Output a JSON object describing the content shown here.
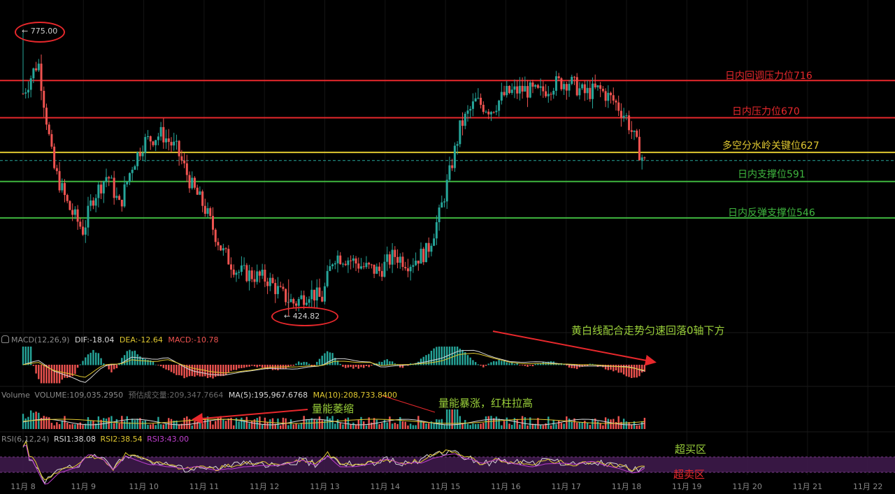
{
  "chart_data": {
    "type": "candlestick",
    "x_ticks": [
      "11月 8",
      "11月 9",
      "11月 10",
      "11月 11",
      "11月 12",
      "11月 13",
      "11月 14",
      "11月 15",
      "11月 16",
      "11月 17",
      "11月 18",
      "11月 19",
      "11月 20",
      "11月 21",
      "11月 22"
    ],
    "price_high_marker": "775.00",
    "price_low_marker": "424.82",
    "ylim": [
      410,
      800
    ],
    "approx_price_path": [
      [
        8.0,
        700
      ],
      [
        8.25,
        740
      ],
      [
        8.5,
        610
      ],
      [
        8.75,
        560
      ],
      [
        9.0,
        530
      ],
      [
        9.15,
        570
      ],
      [
        9.4,
        600
      ],
      [
        9.6,
        560
      ],
      [
        9.8,
        610
      ],
      [
        10.0,
        640
      ],
      [
        10.3,
        650
      ],
      [
        10.55,
        630
      ],
      [
        10.8,
        585
      ],
      [
        11.0,
        560
      ],
      [
        11.3,
        505
      ],
      [
        11.55,
        480
      ],
      [
        11.8,
        475
      ],
      [
        12.05,
        470
      ],
      [
        12.3,
        450
      ],
      [
        12.5,
        440
      ],
      [
        12.75,
        455
      ],
      [
        12.95,
        445
      ],
      [
        13.15,
        500
      ],
      [
        13.4,
        495
      ],
      [
        13.65,
        485
      ],
      [
        13.9,
        480
      ],
      [
        14.15,
        500
      ],
      [
        14.4,
        490
      ],
      [
        14.7,
        505
      ],
      [
        14.9,
        550
      ],
      [
        15.05,
        595
      ],
      [
        15.25,
        660
      ],
      [
        15.5,
        690
      ],
      [
        15.75,
        680
      ],
      [
        16.0,
        700
      ],
      [
        16.3,
        705
      ],
      [
        16.55,
        700
      ],
      [
        16.8,
        712
      ],
      [
        17.05,
        715
      ],
      [
        17.3,
        700
      ],
      [
        17.55,
        705
      ],
      [
        17.8,
        690
      ],
      [
        18.0,
        670
      ],
      [
        18.2,
        630
      ],
      [
        18.3,
        615
      ]
    ],
    "levels": [
      {
        "label": "日内回调压力位716",
        "value": 716,
        "color": "#e8282c"
      },
      {
        "label": "日内压力位670",
        "value": 670,
        "color": "#e8282c"
      },
      {
        "label": "多空分水岭关键位627",
        "value": 627,
        "color": "#e0c830"
      },
      {
        "label": "日内支撑位591",
        "value": 591,
        "color": "#3fb63f"
      },
      {
        "label": "日内反弹支撑位546",
        "value": 546,
        "color": "#3fb63f"
      }
    ],
    "current_price_dashed": 617,
    "macd": {
      "legend": "MACD(12,26,9)",
      "dif": "DIF:-18.04",
      "dea": "DEA:-12.64",
      "macd": "MACD:-10.78"
    },
    "volume": {
      "legend": "Volume",
      "volume": "VOLUME:109,035.2950",
      "estimate": "预估成交量:209,347.7664",
      "ma5": "MA(5):195,967.6768",
      "ma10": "MA(10):208,733.8400"
    },
    "rsi": {
      "legend": "RSI(6,12,24)",
      "rsi1": "RSI1:38.08",
      "rsi2": "RSI2:38.54",
      "rsi3": "RSI3:43.00"
    }
  },
  "annotations": {
    "macd_note": "黄白线配合走势匀速回落0轴下方",
    "volume_shrink": "量能萎缩",
    "volume_surge": "量能暴涨，红柱拉高",
    "overbought": "超买区",
    "oversold": "超卖区"
  },
  "colors": {
    "up": "#26a69a",
    "down": "#ef5350",
    "red_line": "#e8282c",
    "yellow_line": "#e0c830",
    "green_line": "#3fb63f",
    "rsi_band": "#3d1a4a"
  }
}
